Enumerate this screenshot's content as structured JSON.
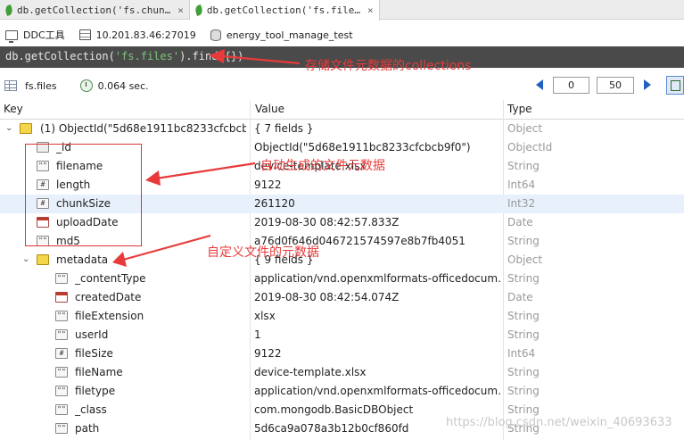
{
  "tabs": [
    {
      "label": "db.getCollection('fs.chun…",
      "close": "×"
    },
    {
      "label": "db.getCollection('fs.file…",
      "close": "×"
    }
  ],
  "connection": {
    "name": "DDC工具",
    "server": "10.201.83.46:27019",
    "database": "energy_tool_manage_test"
  },
  "query": {
    "prefix": "db.getCollection(",
    "string": "'fs.files'",
    "suffix": ").find({})"
  },
  "results": {
    "collection": "fs.files",
    "time": "0.064 sec.",
    "page_start": "0",
    "page_size": "50"
  },
  "table": {
    "headers": {
      "key": "Key",
      "value": "Value",
      "type": "Type"
    },
    "rows": [
      {
        "key": "(1) ObjectId(\"5d68e1911bc8233cfcbcb…",
        "value": "{ 7 fields }",
        "type": "Object",
        "icon": "object-icon"
      },
      {
        "key": "_id",
        "value": "ObjectId(\"5d68e1911bc8233cfcbcb9f0\")",
        "type": "ObjectId",
        "icon": "objectid-icon"
      },
      {
        "key": "filename",
        "value": "device-template.xlsx",
        "type": "String",
        "icon": "string-icon"
      },
      {
        "key": "length",
        "value": "9122",
        "type": "Int64",
        "icon": "number-icon"
      },
      {
        "key": "chunkSize",
        "value": "261120",
        "type": "Int32",
        "icon": "number-icon"
      },
      {
        "key": "uploadDate",
        "value": "2019-08-30 08:42:57.833Z",
        "type": "Date",
        "icon": "date-icon"
      },
      {
        "key": "md5",
        "value": "a76d0f646d046721574597e8b7fb4051",
        "type": "String",
        "icon": "string-icon"
      },
      {
        "key": "metadata",
        "value": "{ 9 fields }",
        "type": "Object",
        "icon": "object-icon"
      },
      {
        "key": "_contentType",
        "value": "application/vnd.openxmlformats-officedocum…",
        "type": "String",
        "icon": "string-icon"
      },
      {
        "key": "createdDate",
        "value": "2019-08-30 08:42:54.074Z",
        "type": "Date",
        "icon": "date-icon"
      },
      {
        "key": "fileExtension",
        "value": "xlsx",
        "type": "String",
        "icon": "string-icon"
      },
      {
        "key": "userId",
        "value": "1",
        "type": "String",
        "icon": "string-icon"
      },
      {
        "key": "fileSize",
        "value": "9122",
        "type": "Int64",
        "icon": "number-icon"
      },
      {
        "key": "fileName",
        "value": "device-template.xlsx",
        "type": "String",
        "icon": "string-icon"
      },
      {
        "key": "filetype",
        "value": "application/vnd.openxmlformats-officedocum…",
        "type": "String",
        "icon": "string-icon"
      },
      {
        "key": "_class",
        "value": "com.mongodb.BasicDBObject",
        "type": "String",
        "icon": "string-icon"
      },
      {
        "key": "path",
        "value": "5d6ca9a078a3b12b0cf860fd",
        "type": "String",
        "icon": "string-icon"
      }
    ]
  },
  "annotations": {
    "query_note": "存储文件元数据的collections",
    "auto_note": "自动生成的文件元数据",
    "custom_note": "自定义文件的元数据",
    "color": "#e83a3a"
  },
  "watermark": "https://blog.csdn.net/weixin_40693633"
}
